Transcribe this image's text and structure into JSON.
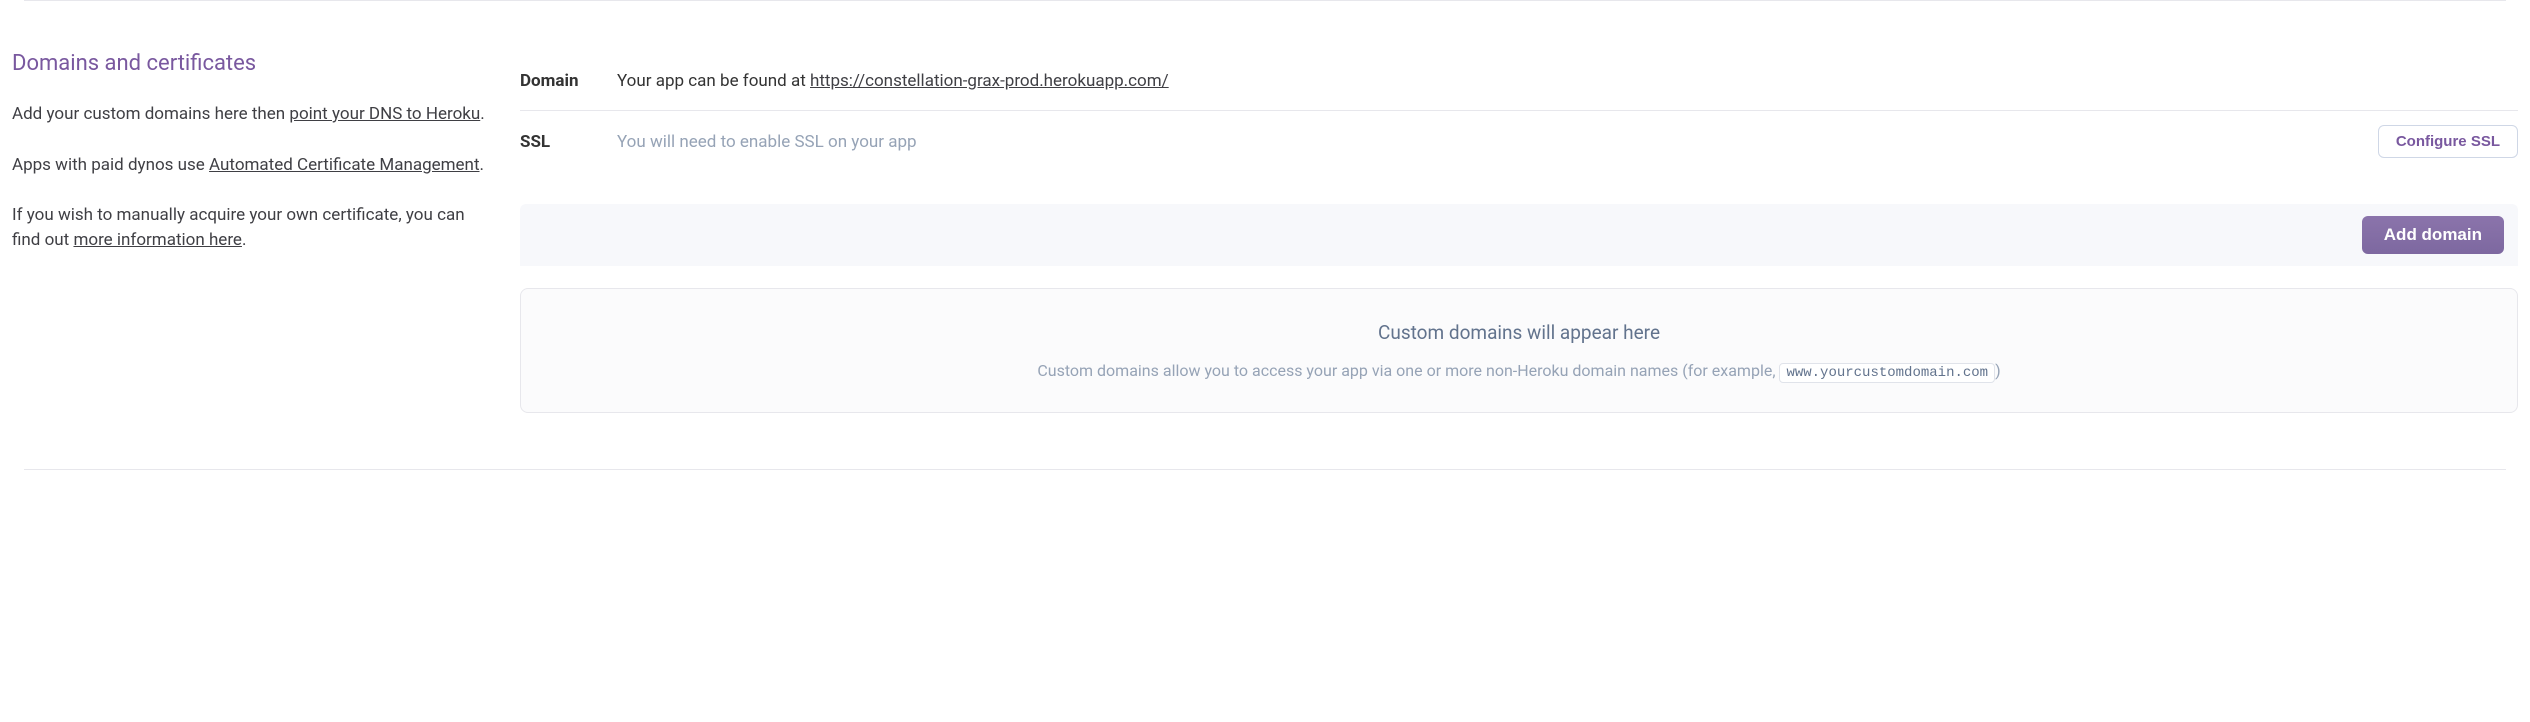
{
  "sidebar": {
    "title": "Domains and certificates",
    "p1_a": "Add your custom domains here then ",
    "p1_link": "point your DNS to Heroku",
    "p1_b": ".",
    "p2_a": "Apps with paid dynos use ",
    "p2_link": "Automated Certificate Management",
    "p2_b": ".",
    "p3_a": "If you wish to manually acquire your own certificate, you can find out ",
    "p3_link": "more information here",
    "p3_b": "."
  },
  "domain_row": {
    "label": "Domain",
    "text": "Your app can be found at ",
    "url": "https://constellation-grax-prod.herokuapp.com/"
  },
  "ssl_row": {
    "label": "SSL",
    "text": "You will need to enable SSL on your app",
    "button": "Configure SSL"
  },
  "add_bar": {
    "button": "Add domain"
  },
  "empty": {
    "title": "Custom domains will appear here",
    "desc_a": "Custom domains allow you to access your app via one or more non-Heroku domain names (for example, ",
    "code": "www.yourcustomdomain.com",
    "desc_b": ")"
  }
}
